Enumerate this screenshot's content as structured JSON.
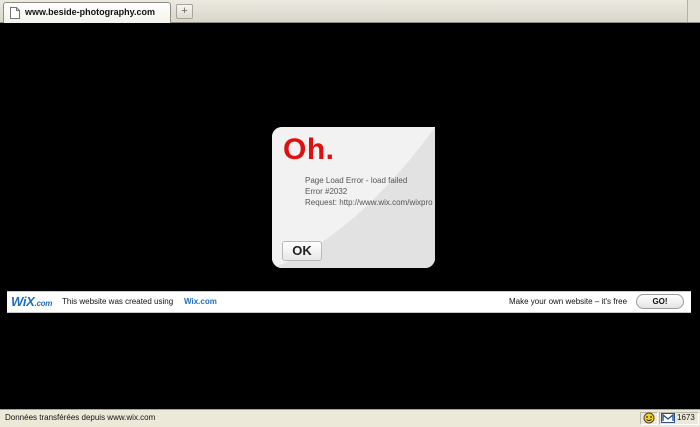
{
  "browser": {
    "tab_title": "www.beside-photography.com",
    "new_tab_symbol": "+",
    "status_text": "Données transférées depuis www.wix.com",
    "mail_count": "1673"
  },
  "dialog": {
    "heading": "Oh.",
    "lines": [
      "Page Load Error - load failed",
      "Error #2032",
      "Request: http://www.wix.com/wixpro"
    ],
    "ok_label": "OK"
  },
  "wix_banner": {
    "logo": "WiX",
    "logo_suffix": ".com",
    "created_text": "This website was created using",
    "wix_link": "Wix.com",
    "make_text": "Make your own website – it's free",
    "go_label": "GO!"
  },
  "colors": {
    "error_red": "#e01010",
    "wix_blue": "#1a6fbf",
    "page_bg": "#000000"
  },
  "icons": [
    "page-icon",
    "new-tab-icon",
    "smiley-icon",
    "mail-icon"
  ]
}
